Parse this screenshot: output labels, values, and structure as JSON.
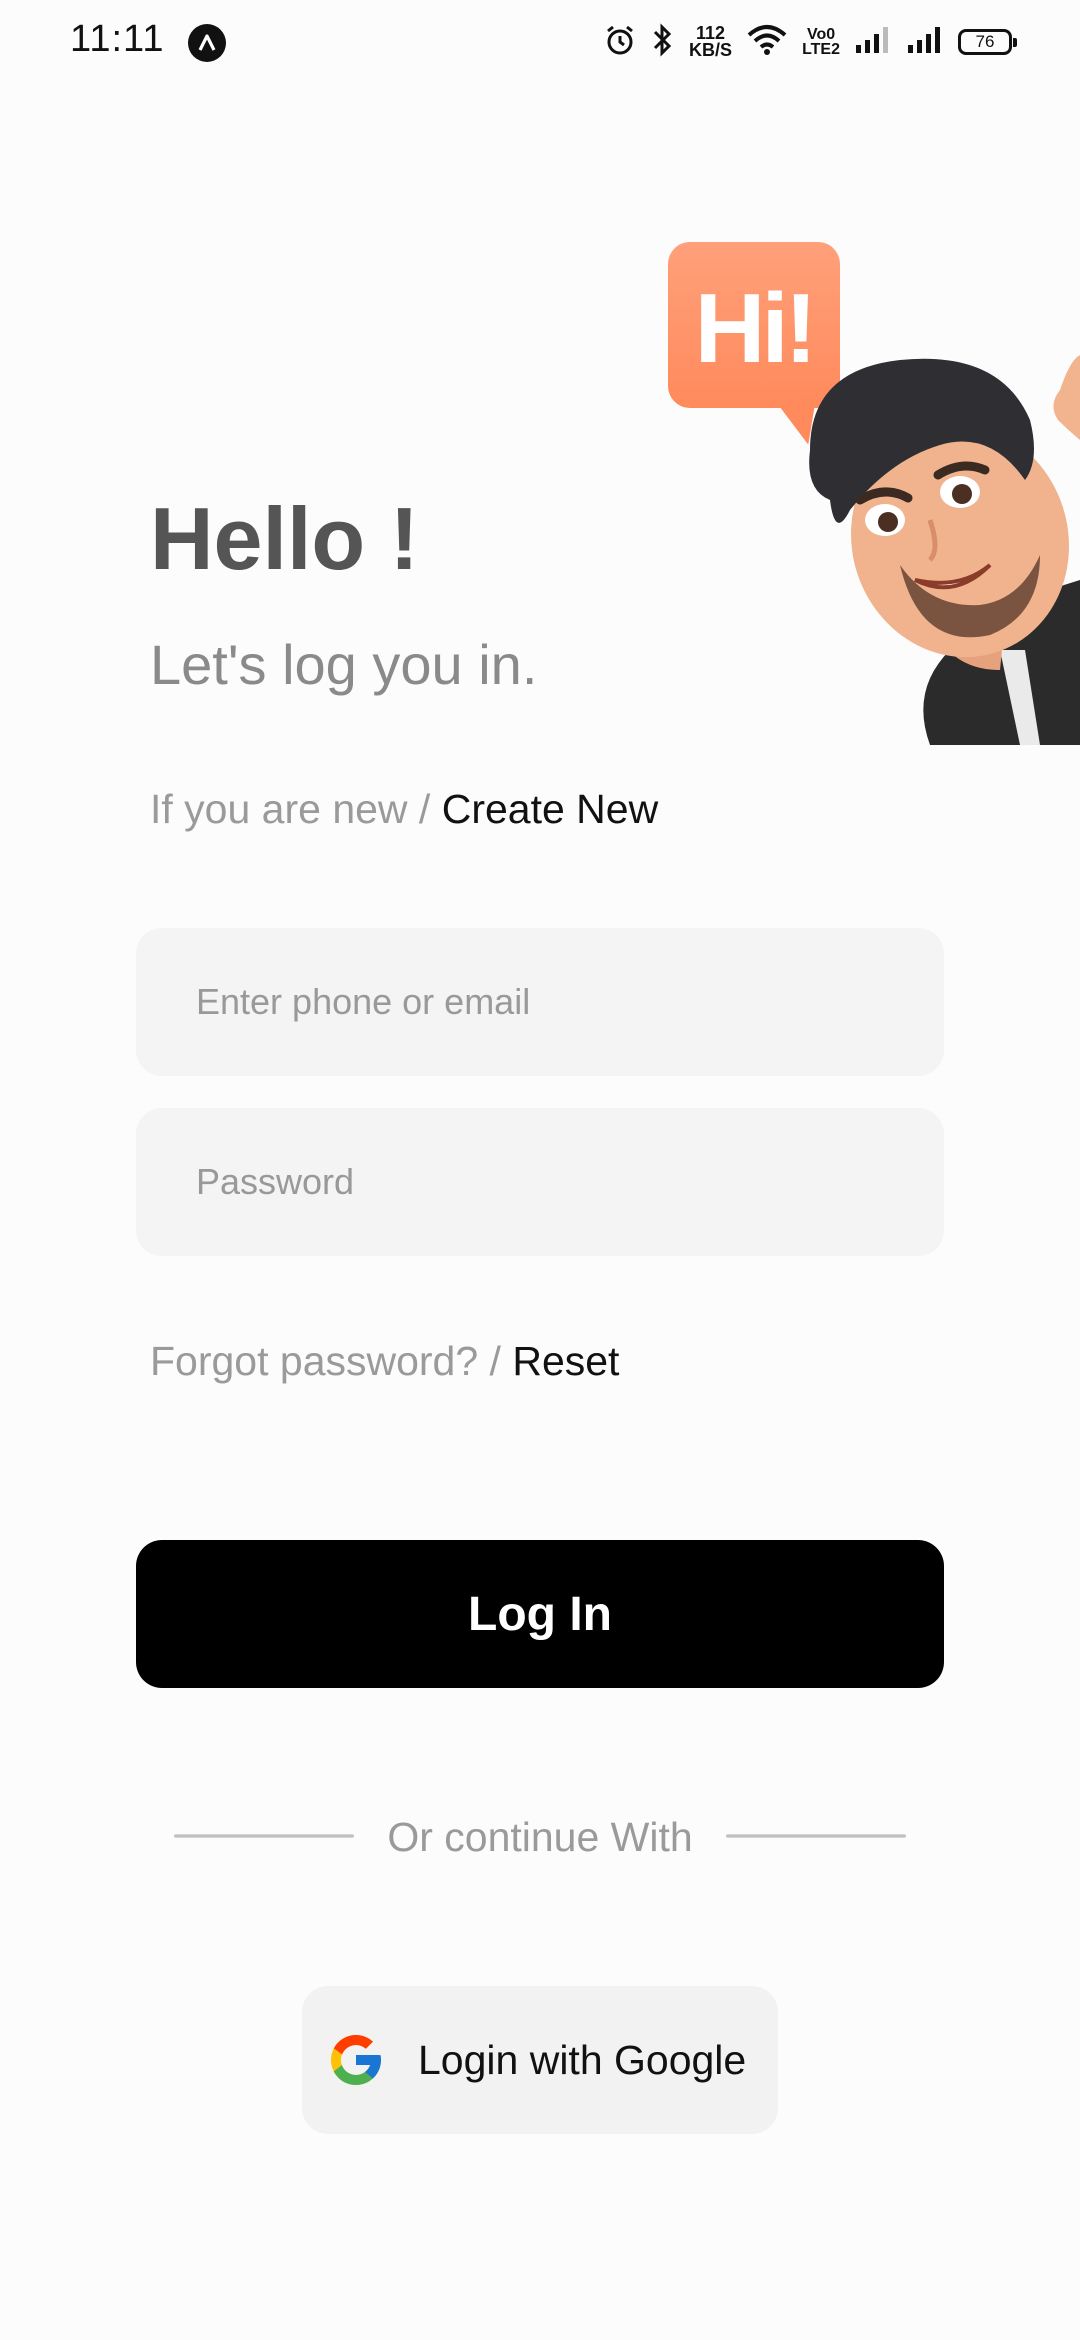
{
  "status_bar": {
    "time": "11:11",
    "network_speed_value": "112",
    "network_speed_unit": "KB/S",
    "volte_top": "Vo0",
    "volte_bottom": "LTE2",
    "battery": "76",
    "icons": [
      "app-notification-icon",
      "alarm-icon",
      "bluetooth-icon",
      "wifi-icon",
      "signal-icon",
      "signal-icon",
      "battery-icon"
    ]
  },
  "hero": {
    "bubble_text": "Hi!",
    "avatar_icon": "waving-memoji-avatar"
  },
  "header": {
    "title": "Hello !",
    "subtitle": "Let's log you in."
  },
  "signup": {
    "prompt": "If you are new / ",
    "link": "Create New"
  },
  "form": {
    "email_placeholder": "Enter phone or email",
    "password_placeholder": "Password"
  },
  "forgot": {
    "prompt": "Forgot password? / ",
    "link": "Reset"
  },
  "login_button": "Log In",
  "divider_text": "Or continue With",
  "google": {
    "label": "Login with Google",
    "icon": "google-icon"
  },
  "colors": {
    "accent_bubble": "#ff8a5c",
    "button_bg": "#000000",
    "field_bg": "#f4f4f4"
  }
}
